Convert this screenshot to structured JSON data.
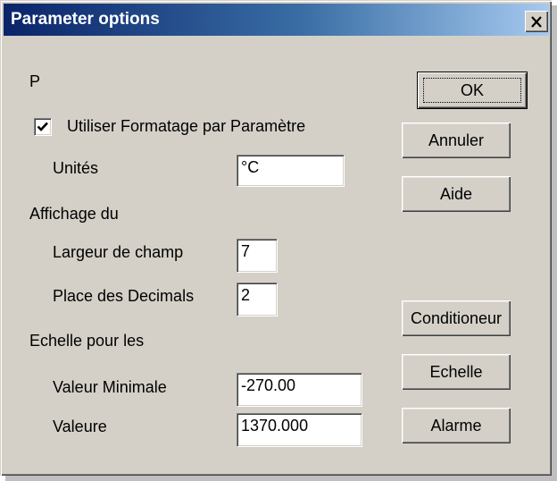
{
  "window": {
    "title": "Parameter options",
    "close_icon": "close-icon"
  },
  "content": {
    "param_name": "P",
    "use_formatting": {
      "label": "Utiliser Formatage par Paramètre",
      "checked": true
    },
    "units": {
      "label": "Unités",
      "value": "°C"
    },
    "display_section": "Affichage du",
    "field_width": {
      "label": "Largeur de champ",
      "value": "7"
    },
    "decimal_places": {
      "label": "Place des Decimals",
      "value": "2"
    },
    "scale_section": "Echelle pour les",
    "min_value": {
      "label": "Valeur Minimale",
      "value": "-270.00"
    },
    "max_value": {
      "label": "Valeure",
      "value": "1370.000"
    }
  },
  "buttons": {
    "ok": "OK",
    "cancel": "Annuler",
    "help": "Aide",
    "conditioner": "Conditioneur",
    "scale": "Echelle",
    "alarm": "Alarme"
  }
}
